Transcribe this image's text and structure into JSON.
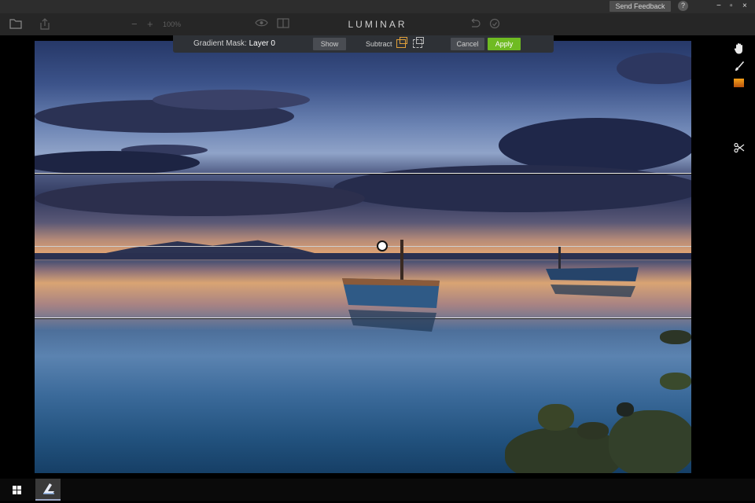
{
  "window": {
    "send_feedback": "Send Feedback",
    "help": "?",
    "minimize": "−",
    "maximize": "▫",
    "close": "×"
  },
  "toolbar": {
    "logo": "LUMINAR",
    "zoom_level": "100%"
  },
  "mask_bar": {
    "title_prefix": "Gradient Mask:",
    "layer_name": "Layer 0",
    "show_label": "Show",
    "subtract_label": "Subtract",
    "cancel_label": "Cancel",
    "apply_label": "Apply"
  },
  "right_tools": [
    "hand-icon",
    "brush-icon",
    "gradient-icon",
    "scissors-icon"
  ],
  "colors": {
    "apply": "#6fbb22",
    "accent_orange": "#e0a03a",
    "titlebar": "#2d2d2d",
    "toolbar": "#262626",
    "maskbar": "#2e3136"
  },
  "taskbar": {
    "apps": [
      "windows-start-icon",
      "luminar-app-icon"
    ]
  }
}
